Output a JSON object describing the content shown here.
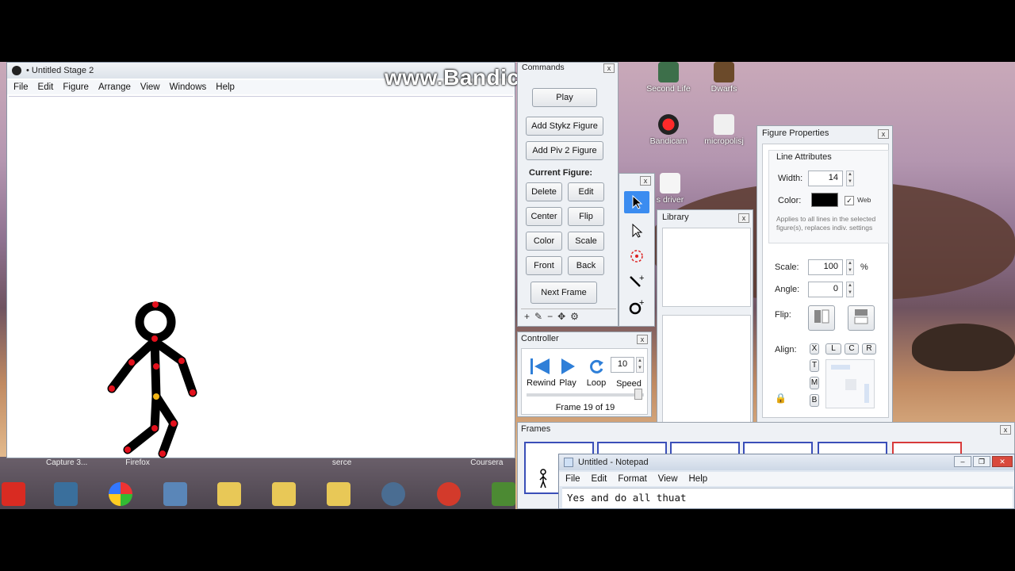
{
  "watermark": "www.Bandicam.com",
  "stage": {
    "title": "• Untitled Stage 2",
    "menu": [
      "File",
      "Edit",
      "Figure",
      "Arrange",
      "View",
      "Windows",
      "Help"
    ]
  },
  "commands": {
    "title": "Commands",
    "play": "Play",
    "add_stykz": "Add Stykz Figure",
    "add_piv2": "Add Piv 2 Figure",
    "current_figure": "Current Figure:",
    "delete": "Delete",
    "edit": "Edit",
    "center": "Center",
    "flip": "Flip",
    "color": "Color",
    "scale": "Scale",
    "front": "Front",
    "back": "Back",
    "next_frame": "Next Frame"
  },
  "library": {
    "title": "Library"
  },
  "controller": {
    "title": "Controller",
    "rewind": "Rewind",
    "play": "Play",
    "loop": "Loop",
    "speed_label": "Speed",
    "speed_value": "10",
    "frame_status": "Frame 19 of 19"
  },
  "figure_properties": {
    "title": "Figure Properties",
    "line_attributes": "Line Attributes",
    "width_label": "Width:",
    "width_value": "14",
    "color_label": "Color:",
    "web_label": "Web",
    "note": "Applies to all lines in the selected figure(s), replaces indiv. settings",
    "scale_label": "Scale:",
    "scale_value": "100",
    "percent": "%",
    "angle_label": "Angle:",
    "angle_value": "0",
    "flip_label": "Flip:",
    "align_label": "Align:",
    "align_x": "X",
    "align_l": "L",
    "align_c": "C",
    "align_r": "R",
    "align_t": "T",
    "align_m": "M",
    "align_b": "B"
  },
  "frames": {
    "title": "Frames"
  },
  "notepad": {
    "title": "Untitled - Notepad",
    "menu": [
      "File",
      "Edit",
      "Format",
      "View",
      "Help"
    ],
    "content": "Yes and do all thuat"
  },
  "desktop_icons": [
    "Second Life",
    "Dwarfs",
    "Bandicam",
    "micropolisj",
    "s driver"
  ],
  "taskbar_labels": [
    "Capture 3...",
    "Firefox",
    "serce",
    "Coursera"
  ],
  "colors": {
    "accent": "#3b8cf0",
    "joint": "#e3101c",
    "center_joint": "#f2b517",
    "figure": "#000000"
  }
}
